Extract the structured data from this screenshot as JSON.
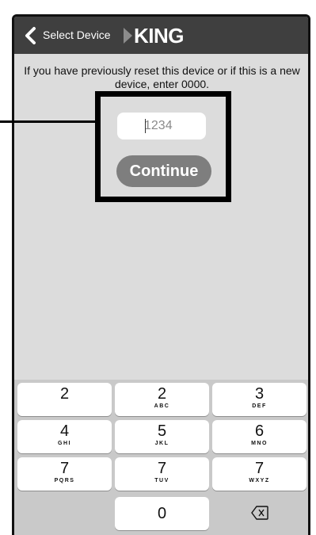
{
  "header": {
    "back_label": "Select Device",
    "logo_text": "KING"
  },
  "instruction": "If you have previously reset this device or if this is a new device, enter 0000.",
  "pin_field": {
    "placeholder": "1234",
    "value": ""
  },
  "continue_label": "Continue",
  "keypad": {
    "rows": [
      [
        {
          "num": "2",
          "letters": ""
        },
        {
          "num": "2",
          "letters": "ABC"
        },
        {
          "num": "3",
          "letters": "DEF"
        }
      ],
      [
        {
          "num": "4",
          "letters": "GHI"
        },
        {
          "num": "5",
          "letters": "JKL"
        },
        {
          "num": "6",
          "letters": "MNO"
        }
      ],
      [
        {
          "num": "7",
          "letters": "PQRS"
        },
        {
          "num": "7",
          "letters": "TUV"
        },
        {
          "num": "7",
          "letters": "WXYZ"
        }
      ],
      [
        {
          "num": "0",
          "letters": ""
        }
      ]
    ]
  },
  "colors": {
    "header_bg": "#3f3f3f",
    "screen_bg": "#dcdcdc",
    "keypad_bg": "#c9c9c9",
    "continue_bg": "#7e7e7e",
    "callout": "#000000"
  },
  "icons": {
    "back": "chevron-left-icon",
    "logo": "king-logo-triangle",
    "delete": "backspace-icon"
  }
}
